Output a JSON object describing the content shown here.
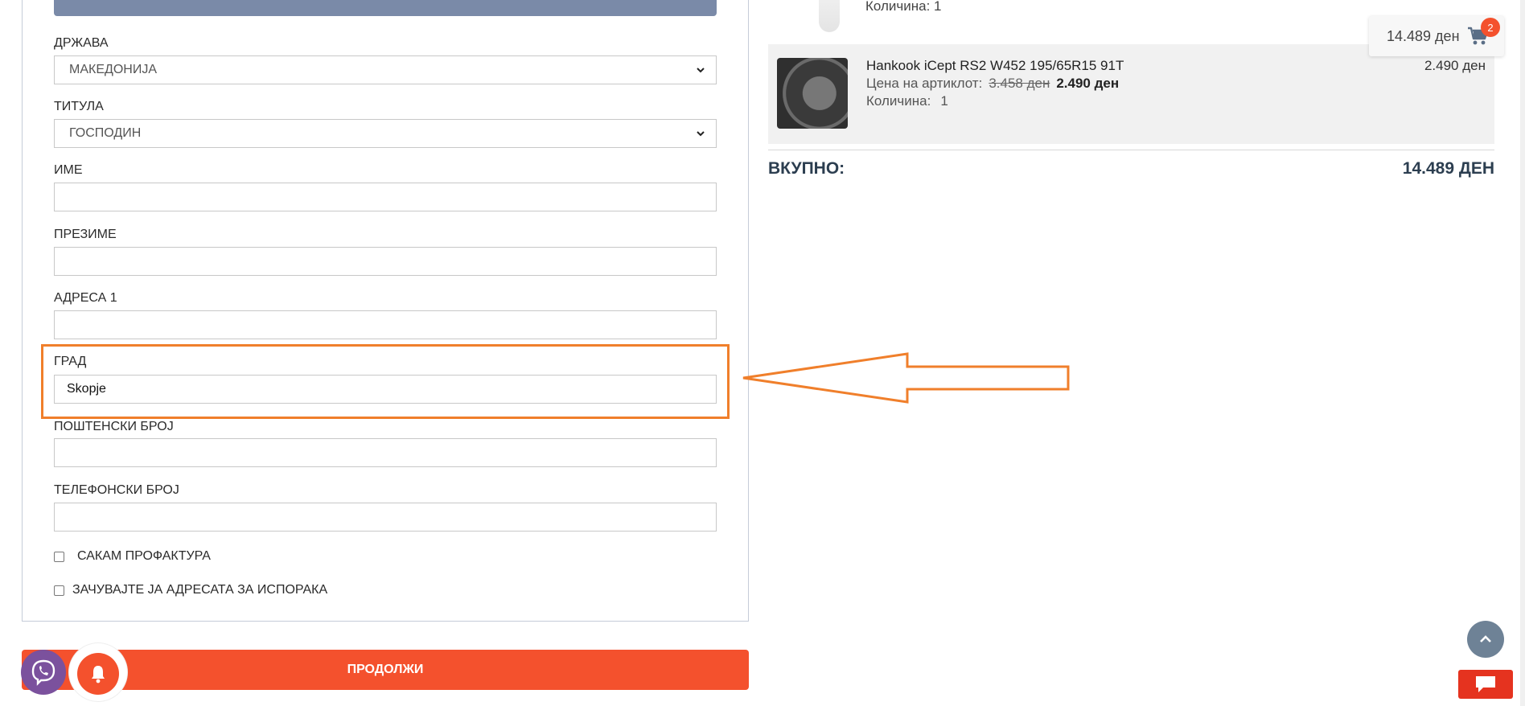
{
  "form": {
    "country": {
      "label": "ДРЖАВА",
      "value": "МАКЕДОНИЈА"
    },
    "title": {
      "label": "ТИТУЛА",
      "value": "ГОСПОДИН"
    },
    "first_name": {
      "label": "ИМЕ",
      "value": ""
    },
    "last_name": {
      "label": "ПРЕЗИМЕ",
      "value": ""
    },
    "address1": {
      "label": "АДРЕСА 1",
      "value": ""
    },
    "city": {
      "label": "ГРАД",
      "value": "Skopje"
    },
    "postal_code": {
      "label": "ПОШТЕНСКИ БРОЈ",
      "value": ""
    },
    "phone": {
      "label": "ТЕЛЕФОНСКИ БРОЈ",
      "value": ""
    },
    "proforma_label": "САКАМ ПРОФАКТУРА",
    "save_address_label": "ЗАЧУВАЈТЕ ЈА АДРЕСАТА ЗА ИСПОРАКА",
    "continue_label": "ПРОДОЛЖИ"
  },
  "cart": {
    "partial_item_text": "Количина: 1",
    "item": {
      "name": "Hankook iCept RS2 W452 195/65R15 91T",
      "price_label": "Цена на артиклот:",
      "old_price": "3.458 ден",
      "new_price": "2.490 ден",
      "qty_label": "Количина:",
      "qty": "1",
      "line_total": "2.490 ден"
    },
    "total_label": "ВКУПНО:",
    "total_value": "14.489 ДЕН"
  },
  "mini_cart": {
    "amount": "14.489 ден",
    "badge": "2"
  },
  "icons": {
    "cart": "cart-icon",
    "chevron": "chevron-down-icon",
    "scroll_top": "chevron-up-icon",
    "chat": "chat-icon",
    "viber": "viber-icon",
    "bell": "bell-icon"
  },
  "colors": {
    "accent": "#f4512d",
    "highlight": "#f07f2b",
    "scroll_top_bg": "#6e8296",
    "viber": "#7b519d"
  }
}
